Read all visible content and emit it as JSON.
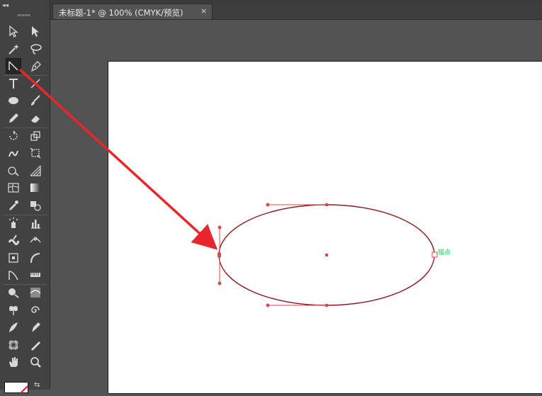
{
  "tab": {
    "title": "未标题-1* @ 100% (CMYK/预览)",
    "close": "×"
  },
  "toolbox": {
    "collapse": "◂◂",
    "swap": "⇆",
    "tools": [
      {
        "name": "selection-tool",
        "icon": "selection-arrow-icon",
        "active": false
      },
      {
        "name": "direct-selection-tool",
        "icon": "direct-selection-arrow-icon",
        "active": false
      },
      {
        "name": "magic-wand-tool",
        "icon": "magic-wand-icon",
        "active": false
      },
      {
        "name": "lasso-tool",
        "icon": "lasso-icon",
        "active": false
      },
      {
        "name": "line-segment-tool",
        "icon": "line-segment-icon",
        "active": true
      },
      {
        "name": "pen-tool",
        "icon": "pen-icon",
        "active": false
      },
      {
        "name": "type-tool",
        "icon": "type-icon",
        "active": false
      },
      {
        "name": "line-tool",
        "icon": "line-icon",
        "active": false
      },
      {
        "name": "ellipse-tool",
        "icon": "ellipse-icon",
        "active": false
      },
      {
        "name": "paintbrush-tool",
        "icon": "paintbrush-icon",
        "active": false
      },
      {
        "name": "pencil-tool",
        "icon": "pencil-icon",
        "active": false
      },
      {
        "name": "eraser-tool",
        "icon": "eraser-icon",
        "active": false
      },
      {
        "name": "rotate-tool",
        "icon": "rotate-icon",
        "active": false
      },
      {
        "name": "scale-tool",
        "icon": "scale-icon",
        "active": false
      },
      {
        "name": "warp-tool",
        "icon": "warp-icon",
        "active": false
      },
      {
        "name": "free-transform-tool",
        "icon": "free-transform-icon",
        "active": false
      },
      {
        "name": "shape-builder-tool",
        "icon": "shape-builder-icon",
        "active": false
      },
      {
        "name": "perspective-grid-tool",
        "icon": "perspective-grid-icon",
        "active": false
      },
      {
        "name": "mesh-tool",
        "icon": "mesh-icon",
        "active": false
      },
      {
        "name": "gradient-tool",
        "icon": "gradient-icon",
        "active": false
      },
      {
        "name": "eyedropper-tool",
        "icon": "eyedropper-icon",
        "active": false
      },
      {
        "name": "blend-tool",
        "icon": "blend-icon",
        "active": false
      },
      {
        "name": "symbol-sprayer-tool",
        "icon": "symbol-sprayer-icon",
        "active": false
      },
      {
        "name": "column-graph-tool",
        "icon": "column-graph-icon",
        "active": false
      },
      {
        "name": "blob-brush-tool",
        "icon": "blob-brush-icon",
        "active": false
      },
      {
        "name": "width-tool",
        "icon": "width-icon",
        "active": false
      },
      {
        "name": "bounding-box-tool",
        "icon": "bounding-box-icon",
        "active": false
      },
      {
        "name": "arc-tool",
        "icon": "arc-icon",
        "active": false
      },
      {
        "name": "curvature-tool",
        "icon": "curvature-icon",
        "active": false
      },
      {
        "name": "ruler-tool",
        "icon": "ruler-icon",
        "active": false
      },
      {
        "name": "brush-mask-tool",
        "icon": "brush-mask-icon",
        "active": false
      },
      {
        "name": "texture-tool",
        "icon": "texture-icon",
        "active": false
      },
      {
        "name": "butterfly-tool",
        "icon": "butterfly-icon",
        "active": false
      },
      {
        "name": "spiral-tool",
        "icon": "spiral-icon",
        "active": false
      },
      {
        "name": "feather-tool",
        "icon": "feather-icon",
        "active": false
      },
      {
        "name": "ink-pen-tool",
        "icon": "ink-pen-icon",
        "active": false
      },
      {
        "name": "artboard-tool",
        "icon": "artboard-icon",
        "active": false
      },
      {
        "name": "slice-tool",
        "icon": "slice-icon",
        "active": false
      },
      {
        "name": "hand-tool",
        "icon": "hand-icon",
        "active": false
      },
      {
        "name": "zoom-tool",
        "icon": "zoom-icon",
        "active": false
      }
    ]
  },
  "canvas": {
    "anchor_label": "锚点",
    "path_color": "#8b1a1a",
    "handle_color": "#e0464a",
    "arrow_color": "#e8262b",
    "anchor_label_color": "#22d64a"
  }
}
